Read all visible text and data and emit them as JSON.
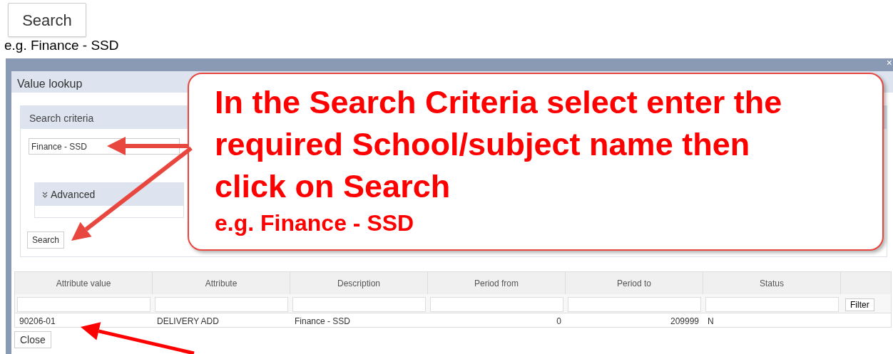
{
  "top_button": "Search",
  "caption": "e.g. Finance - SSD",
  "dialog": {
    "title": "Value lookup",
    "close": "×",
    "search_criteria": {
      "title": "Search criteria",
      "value": "Finance - SSD",
      "advanced": "Advanced",
      "button": "Search"
    },
    "table": {
      "columns": [
        {
          "label": "Attribute value",
          "kind": "text"
        },
        {
          "label": "Attribute",
          "kind": "text"
        },
        {
          "label": "Description",
          "kind": "text"
        },
        {
          "label": "Period from",
          "kind": "number"
        },
        {
          "label": "Period to",
          "kind": "number"
        },
        {
          "label": "Status",
          "kind": "text"
        }
      ],
      "filter_button": "Filter",
      "rows": [
        {
          "cells": [
            "90206-01",
            "DELIVERY ADD",
            "Finance - SSD",
            "0",
            "209999",
            "N"
          ]
        }
      ]
    },
    "close_button": "Close"
  },
  "callout": {
    "lines": [
      "In the Search Criteria select enter the",
      "required School/subject name then",
      "click on Search"
    ],
    "note": "e.g. Finance - SSD"
  }
}
